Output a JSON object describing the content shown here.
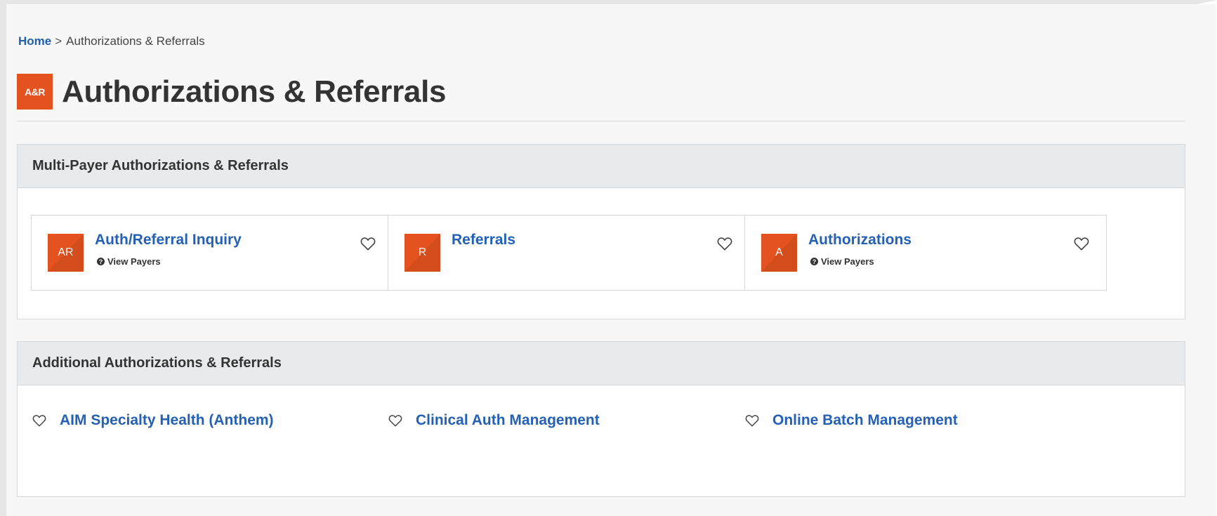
{
  "breadcrumb": {
    "home": "Home",
    "separator": ">",
    "current": "Authorizations & Referrals"
  },
  "page": {
    "badge": "A&R",
    "title": "Authorizations & Referrals"
  },
  "sections": [
    {
      "title": "Multi-Payer Authorizations & Referrals",
      "cards": [
        {
          "badge": "AR",
          "title": "Auth/Referral Inquiry",
          "sub_icon": "question-circle-icon",
          "sub": "View Payers",
          "favorite_icon": "heart-outline-icon"
        },
        {
          "badge": "R",
          "title": "Referrals",
          "favorite_icon": "heart-outline-icon"
        },
        {
          "badge": "A",
          "title": "Authorizations",
          "sub_icon": "question-circle-icon",
          "sub": "View Payers",
          "favorite_icon": "heart-outline-icon"
        }
      ]
    },
    {
      "title": "Additional Authorizations & Referrals",
      "links": [
        {
          "label": "AIM Specialty Health (Anthem)",
          "favorite_icon": "heart-outline-icon"
        },
        {
          "label": "Clinical Auth Management",
          "favorite_icon": "heart-outline-icon"
        },
        {
          "label": "Online Batch Management",
          "favorite_icon": "heart-outline-icon"
        }
      ]
    }
  ],
  "colors": {
    "accent": "#e4521f",
    "link": "#2460b5",
    "panel_header_bg": "#e8eaeb",
    "page_bg": "#f7f7f7"
  }
}
